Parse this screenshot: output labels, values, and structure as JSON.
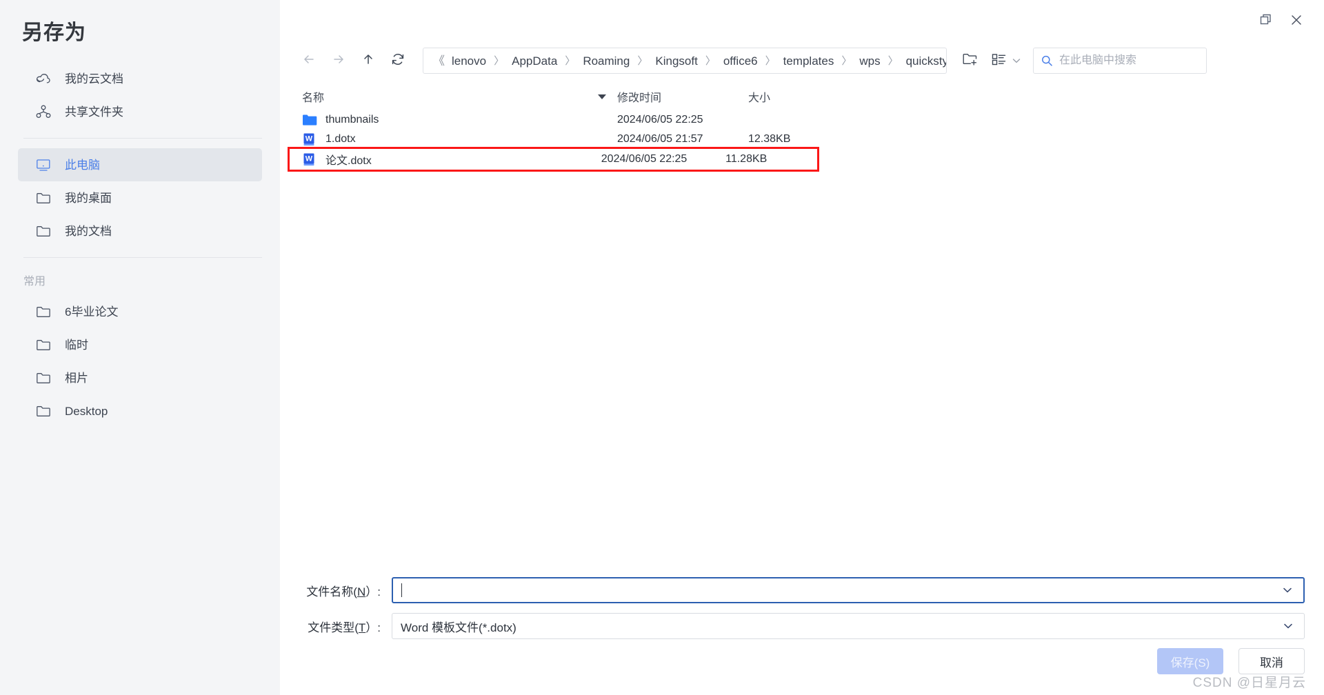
{
  "dialog": {
    "title": "另存为"
  },
  "window_controls": {
    "restore": "restore-icon",
    "close": "close-icon"
  },
  "sidebar": {
    "items": [
      {
        "label": "我的云文档",
        "icon": "cloud-icon",
        "selected": false
      },
      {
        "label": "共享文件夹",
        "icon": "share-nodes-icon",
        "selected": false
      },
      {
        "label": "此电脑",
        "icon": "monitor-icon",
        "selected": true
      },
      {
        "label": "我的桌面",
        "icon": "folder-icon",
        "selected": false
      },
      {
        "label": "我的文档",
        "icon": "folder-icon",
        "selected": false
      }
    ],
    "group_title": "常用",
    "favorites": [
      {
        "label": "6毕业论文",
        "icon": "folder-icon"
      },
      {
        "label": "临时",
        "icon": "folder-icon"
      },
      {
        "label": "相片",
        "icon": "folder-icon"
      },
      {
        "label": "Desktop",
        "icon": "folder-icon"
      }
    ]
  },
  "toolbar": {
    "back": "arrow-left-icon",
    "forward": "arrow-right-icon",
    "up": "arrow-up-icon",
    "refresh": "refresh-icon",
    "new_folder": "new-folder-icon",
    "view_mode": "list-view-icon",
    "view_chevron": "chevron-down-icon",
    "breadcrumb_prefix": "《",
    "breadcrumb_separator": "〉",
    "breadcrumb": [
      "lenovo",
      "AppData",
      "Roaming",
      "Kingsoft",
      "office6",
      "templates",
      "wps",
      "quickstyles"
    ]
  },
  "search": {
    "icon": "search-icon",
    "placeholder": "在此电脑中搜索",
    "value": ""
  },
  "file_list": {
    "columns": [
      "名称",
      "修改时间",
      "大小"
    ],
    "sort_column": "名称",
    "sort_direction": "desc",
    "rows": [
      {
        "name": "thumbnails",
        "modified": "2024/06/05 22:25",
        "size": "",
        "icon": "folder-icon",
        "highlighted": false
      },
      {
        "name": "1.dotx",
        "modified": "2024/06/05 21:57",
        "size": "12.38KB",
        "icon": "word-template-icon",
        "highlighted": false
      },
      {
        "name": "论文.dotx",
        "modified": "2024/06/05 22:25",
        "size": "11.28KB",
        "icon": "word-template-icon",
        "highlighted": true
      }
    ]
  },
  "form": {
    "filename_label_pre": "文件名称(",
    "filename_label_key": "N",
    "filename_label_post": "）:",
    "filename_value": "",
    "filetype_label_pre": "文件类型(",
    "filetype_label_key": "T",
    "filetype_label_post": "）:",
    "filetype_value": "Word 模板文件(*.dotx)"
  },
  "buttons": {
    "save": "保存(S)",
    "cancel": "取消"
  },
  "watermark": "CSDN @日星月云",
  "colors": {
    "sidebar_bg": "#f4f5f7",
    "selected_bg": "#e3e6eb",
    "accent": "#4b7fe8",
    "highlight_red": "#fb1717",
    "folder_blue": "#2b7fff",
    "word_blue": "#2b5ce6",
    "primary_btn": "#b3c6f7"
  }
}
